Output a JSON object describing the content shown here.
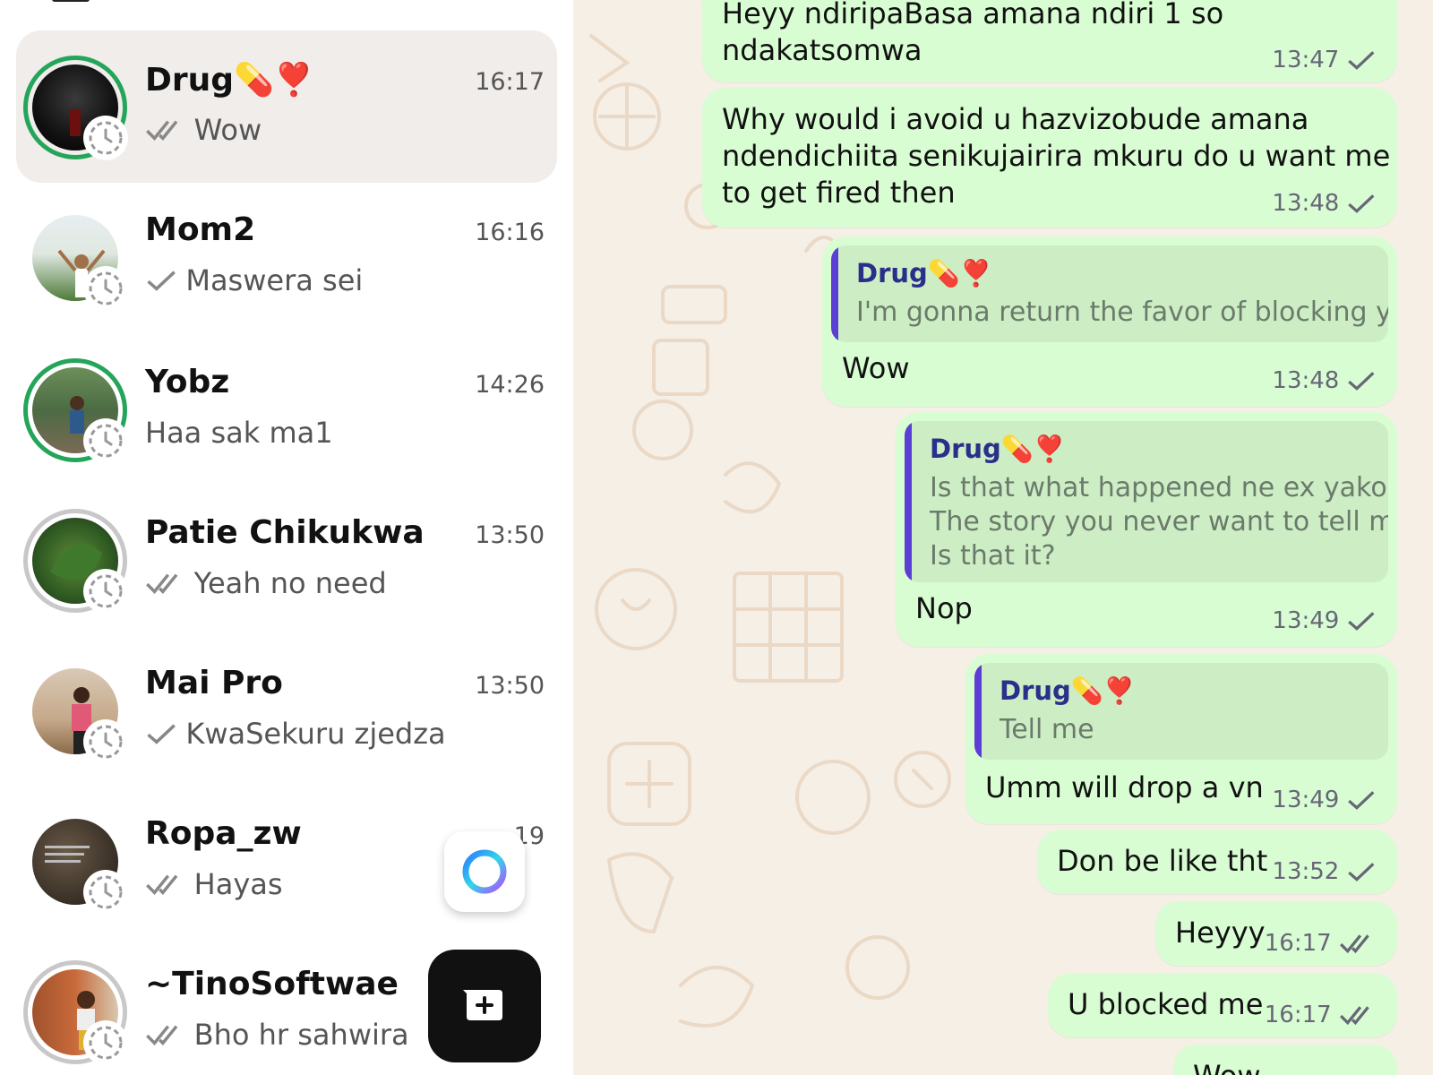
{
  "chat_list": {
    "chats": [
      {
        "name": "Drug💊❣️",
        "time": "16:17",
        "preview": "Wow",
        "tick": "double-check-icon",
        "ring": "green",
        "selected": true
      },
      {
        "name": "Mom2",
        "time": "16:16",
        "preview": "Maswera sei",
        "tick": "check-icon",
        "ring": "none",
        "selected": false
      },
      {
        "name": "Yobz",
        "time": "14:26",
        "preview": "Haa sak ma1",
        "tick": "",
        "ring": "green",
        "selected": false
      },
      {
        "name": "Patie Chikukwa",
        "time": "13:50",
        "preview": "Yeah no need",
        "tick": "double-check-icon",
        "ring": "grey",
        "selected": false
      },
      {
        "name": "Mai Pro",
        "time": "13:50",
        "preview": "KwaSekuru zjedza",
        "tick": "check-icon",
        "ring": "none",
        "selected": false
      },
      {
        "name": "Ropa_zw",
        "time": "19",
        "preview": "Hayas",
        "tick": "double-check-icon",
        "ring": "none",
        "selected": false
      },
      {
        "name": "~TinoSoftwae",
        "time": "",
        "preview": "Bho hr sahwira",
        "tick": "double-check-icon",
        "ring": "grey",
        "selected": false
      }
    ],
    "meta_ai_icon": "meta-ai-icon",
    "new_chat_icon": "new-chat-icon"
  },
  "conversation": {
    "messages": [
      {
        "text_lines": [
          "Heyy ndiripaBasa amana ndiri 1 so",
          "ndakatsomwa"
        ],
        "time": "13:47",
        "tick": "check-icon"
      },
      {
        "text_lines": [
          "Why would i avoid u hazvizobude amana",
          "ndendichiita senikujairira mkuru do u want me",
          "to get fired then"
        ],
        "time": "13:48",
        "tick": "check-icon"
      },
      {
        "quote": {
          "author": "Drug💊❣️",
          "text": "I'm gonna return the favor of blocking you"
        },
        "text_lines": [
          "Wow"
        ],
        "time": "13:48",
        "tick": "check-icon"
      },
      {
        "quote": {
          "author": "Drug💊❣️",
          "text": "Is that what happened ne ex yako\nThe story you never want to tell me\nIs that it?"
        },
        "text_lines": [
          "Nop"
        ],
        "time": "13:49",
        "tick": "check-icon"
      },
      {
        "quote": {
          "author": "Drug💊❣️",
          "text": "Tell me"
        },
        "text_lines": [
          "Umm will drop a vn"
        ],
        "time": "13:49",
        "tick": "check-icon"
      },
      {
        "text_lines": [
          "Don be like tht"
        ],
        "time": "13:52",
        "tick": "check-icon"
      },
      {
        "text_lines": [
          "Heyyy"
        ],
        "time": "16:17",
        "tick": "double-check-icon"
      },
      {
        "text_lines": [
          "U blocked me"
        ],
        "time": "16:17",
        "tick": "double-check-icon"
      },
      {
        "text_lines": [
          "Wow"
        ],
        "time": "",
        "tick": ""
      }
    ]
  },
  "colors": {
    "bubble": "#d9fdd3",
    "quote_bar": "#5b3ed6",
    "status_ring": "#25a55a",
    "selected_row": "#f0edeb"
  }
}
